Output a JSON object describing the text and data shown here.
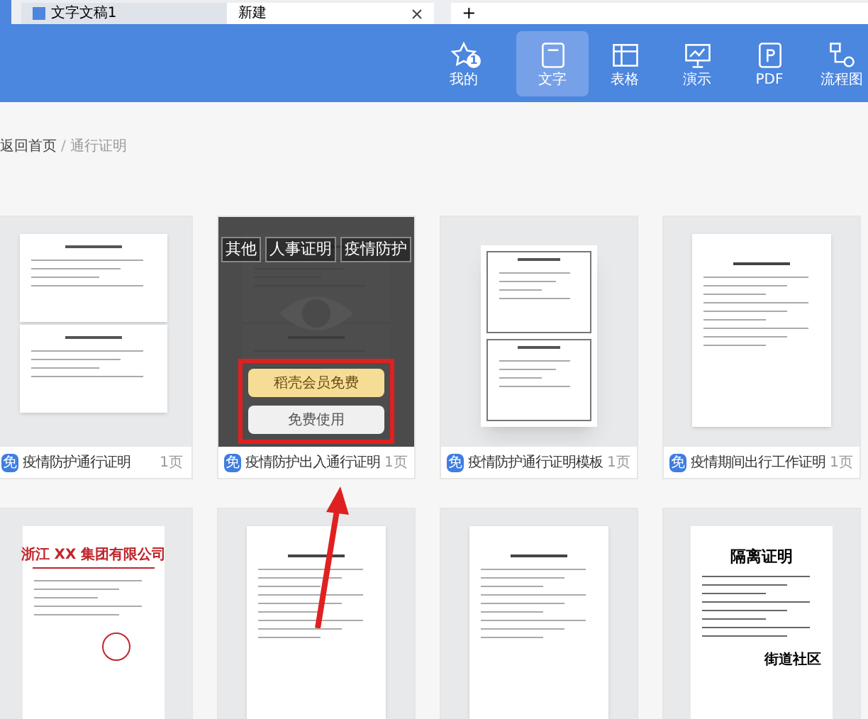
{
  "tabs": [
    {
      "label": "文字文稿1",
      "selected": false,
      "closable": false
    },
    {
      "label": "新建",
      "selected": true,
      "closable": true
    }
  ],
  "new_tab": "+",
  "toolbar": [
    {
      "kind": "star",
      "label": "我的",
      "badge": "1",
      "selected": false
    },
    {
      "kind": "doc",
      "label": "文字",
      "selected": true
    },
    {
      "kind": "table",
      "label": "表格",
      "selected": false
    },
    {
      "kind": "slides",
      "label": "演示",
      "selected": false
    },
    {
      "kind": "pdf",
      "label": "PDF",
      "selected": false
    },
    {
      "kind": "flow",
      "label": "流程图",
      "selected": false
    }
  ],
  "breadcrumb": {
    "home": "返回首页",
    "separator": "/",
    "current": "通行证明"
  },
  "cards": [
    {
      "kind": "double",
      "badge": "免",
      "title": "疫情防护通行证明",
      "pages": "1页"
    },
    {
      "kind": "double",
      "badge": "免",
      "title": "疫情防护出入通行证明",
      "pages": "1页",
      "overlay": {
        "tags": [
          "其他",
          "人事证明",
          "疫情防护"
        ],
        "buttons": [
          {
            "kind": "member",
            "label": "稻壳会员免费"
          },
          {
            "kind": "free",
            "label": "免费使用"
          }
        ]
      }
    },
    {
      "kind": "poster",
      "badge": "免",
      "title": "疫情防护通行证明模板",
      "pages": "1页"
    },
    {
      "kind": "form",
      "badge": "免",
      "title": "疫情期间出行工作证明",
      "pages": "1页"
    },
    {
      "kind": "letterhead",
      "heading": "浙江 XX 集团有限公司"
    },
    {
      "kind": "form"
    },
    {
      "kind": "form"
    },
    {
      "kind": "notice",
      "heading": "隔离证明",
      "signature": "街道社区"
    }
  ]
}
